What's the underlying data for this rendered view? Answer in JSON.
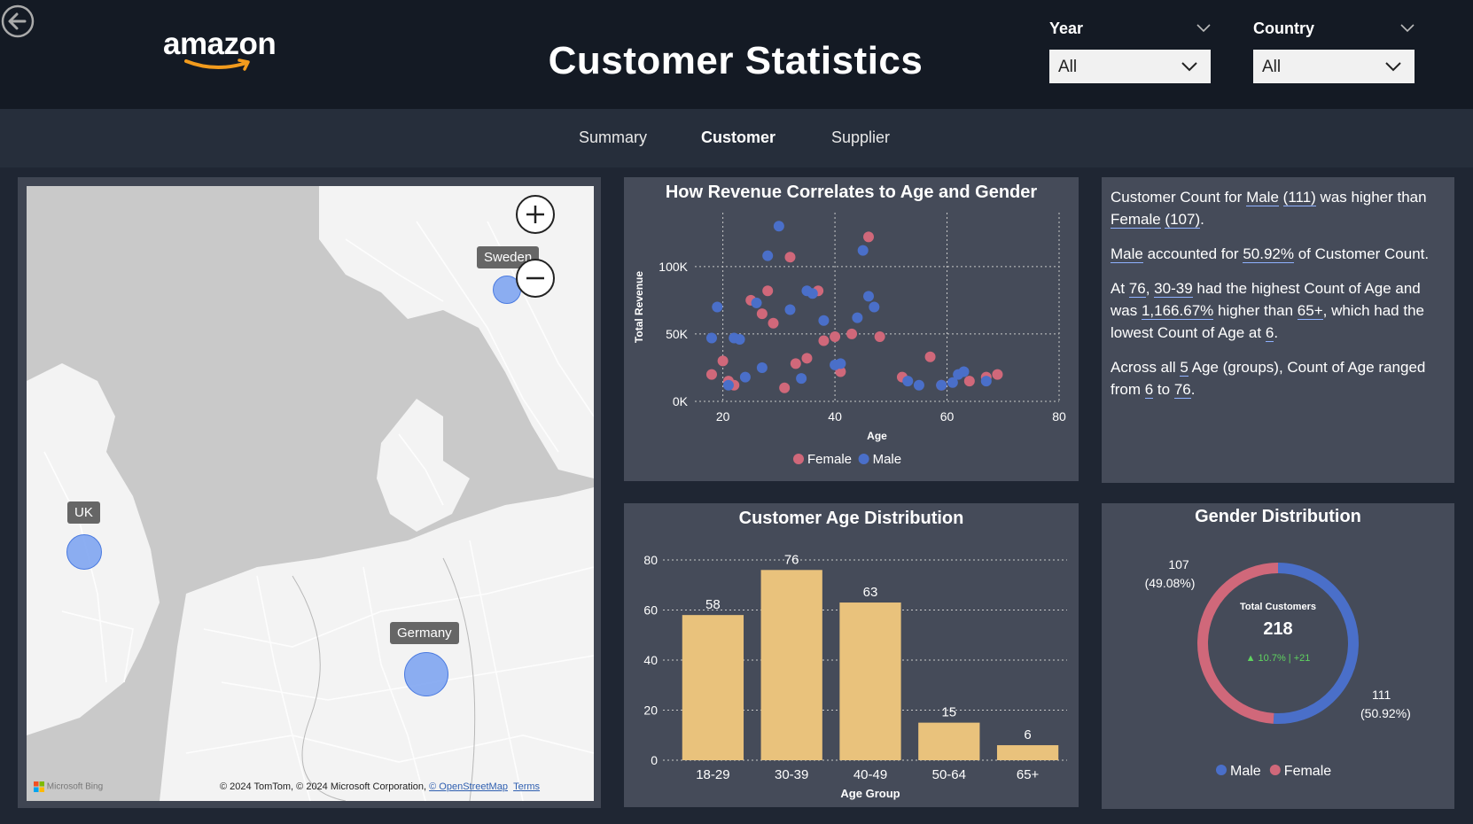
{
  "header": {
    "title": "Customer Statistics",
    "logo_text": "amazon",
    "filters": [
      {
        "label": "Year",
        "value": "All"
      },
      {
        "label": "Country",
        "value": "All"
      }
    ]
  },
  "nav": {
    "tabs": [
      {
        "label": "Summary",
        "active": false
      },
      {
        "label": "Customer",
        "active": true
      },
      {
        "label": "Supplier",
        "active": false
      }
    ]
  },
  "map": {
    "labels": [
      "Sweden",
      "UK",
      "Germany"
    ],
    "attribution": "© 2024 TomTom, © 2024 Microsoft Corporation, ",
    "attribution_link": "© OpenStreetMap",
    "terms": "Terms",
    "provider": "Microsoft Bing"
  },
  "insights": {
    "p1": {
      "a": "Customer Count for ",
      "b": "Male",
      "c": " ",
      "d": "(111)",
      "e": " was higher than ",
      "f": "Female",
      "g": " ",
      "h": "(107)",
      "i": "."
    },
    "p2": {
      "a": "Male",
      "b": " accounted for ",
      "c": "50.92%",
      "d": " of Customer Count."
    },
    "p3": {
      "a": "At ",
      "b": "76",
      "c": ", ",
      "d": "30-39",
      "e": " had the highest Count of Age and was ",
      "f": "1,166.67%",
      "g": " higher than ",
      "h": "65+",
      "i": ", which had the lowest Count of Age at ",
      "j": "6",
      "k": "."
    },
    "p4": {
      "a": "Across all ",
      "b": "5",
      "c": " Age (groups), Count of Age ranged from ",
      "d": "6",
      "e": " to ",
      "f": "76",
      "g": "."
    }
  },
  "colors": {
    "female": "#d0687a",
    "male": "#4a6fc9",
    "bar": "#e9c27c",
    "panel": "#454b59",
    "up": "#5fd35f"
  },
  "chart_data": [
    {
      "type": "scatter",
      "title": "How Revenue Correlates to Age and Gender",
      "xlabel": "Age",
      "ylabel": "Total Revenue",
      "xlim": [
        15,
        80
      ],
      "ylim": [
        0,
        140000
      ],
      "x_ticks": [
        20,
        40,
        60,
        80
      ],
      "y_ticks": [
        0,
        50000,
        100000
      ],
      "y_tick_labels": [
        "0K",
        "50K",
        "100K"
      ],
      "grid": true,
      "legend": "bottom",
      "series": [
        {
          "name": "Female",
          "color": "#d0687a",
          "points": [
            [
              18,
              20000
            ],
            [
              20,
              30000
            ],
            [
              21,
              15000
            ],
            [
              22,
              12000
            ],
            [
              25,
              75000
            ],
            [
              27,
              65000
            ],
            [
              28,
              82000
            ],
            [
              29,
              58000
            ],
            [
              31,
              10000
            ],
            [
              32,
              107000
            ],
            [
              33,
              28000
            ],
            [
              35,
              32000
            ],
            [
              37,
              82000
            ],
            [
              38,
              45000
            ],
            [
              40,
              48000
            ],
            [
              41,
              22000
            ],
            [
              43,
              50000
            ],
            [
              46,
              122000
            ],
            [
              48,
              48000
            ],
            [
              52,
              18000
            ],
            [
              57,
              33000
            ],
            [
              59,
              12000
            ],
            [
              64,
              15000
            ],
            [
              67,
              18000
            ],
            [
              69,
              20000
            ]
          ]
        },
        {
          "name": "Male",
          "color": "#4a6fc9",
          "points": [
            [
              18,
              47000
            ],
            [
              19,
              70000
            ],
            [
              21,
              12000
            ],
            [
              22,
              47000
            ],
            [
              23,
              46000
            ],
            [
              24,
              18000
            ],
            [
              26,
              73000
            ],
            [
              27,
              25000
            ],
            [
              28,
              108000
            ],
            [
              30,
              130000
            ],
            [
              32,
              68000
            ],
            [
              34,
              17000
            ],
            [
              35,
              82000
            ],
            [
              36,
              80000
            ],
            [
              38,
              60000
            ],
            [
              40,
              27000
            ],
            [
              41,
              28000
            ],
            [
              44,
              62000
            ],
            [
              45,
              112000
            ],
            [
              46,
              78000
            ],
            [
              47,
              70000
            ],
            [
              53,
              15000
            ],
            [
              55,
              12000
            ],
            [
              59,
              12000
            ],
            [
              61,
              14000
            ],
            [
              62,
              20000
            ],
            [
              63,
              22000
            ],
            [
              67,
              15000
            ]
          ]
        }
      ]
    },
    {
      "type": "bar",
      "title": "Customer Age Distribution",
      "xlabel": "Age Group",
      "ylabel": "",
      "categories": [
        "18-29",
        "30-39",
        "40-49",
        "50-64",
        "65+"
      ],
      "values": [
        58,
        76,
        63,
        15,
        6
      ],
      "ylim": [
        0,
        80
      ],
      "y_ticks": [
        0,
        20,
        40,
        60,
        80
      ],
      "grid": true
    },
    {
      "type": "pie",
      "title": "Gender Distribution",
      "center_label": "Total Customers",
      "center_value": "218",
      "delta_text": "▲ 10.7%  | +21",
      "legend": "bottom",
      "slices": [
        {
          "name": "Male",
          "value": 111,
          "percent": "(50.92%)",
          "color": "#4a6fc9"
        },
        {
          "name": "Female",
          "value": 107,
          "percent": "(49.08%)",
          "color": "#d0687a"
        }
      ]
    }
  ]
}
